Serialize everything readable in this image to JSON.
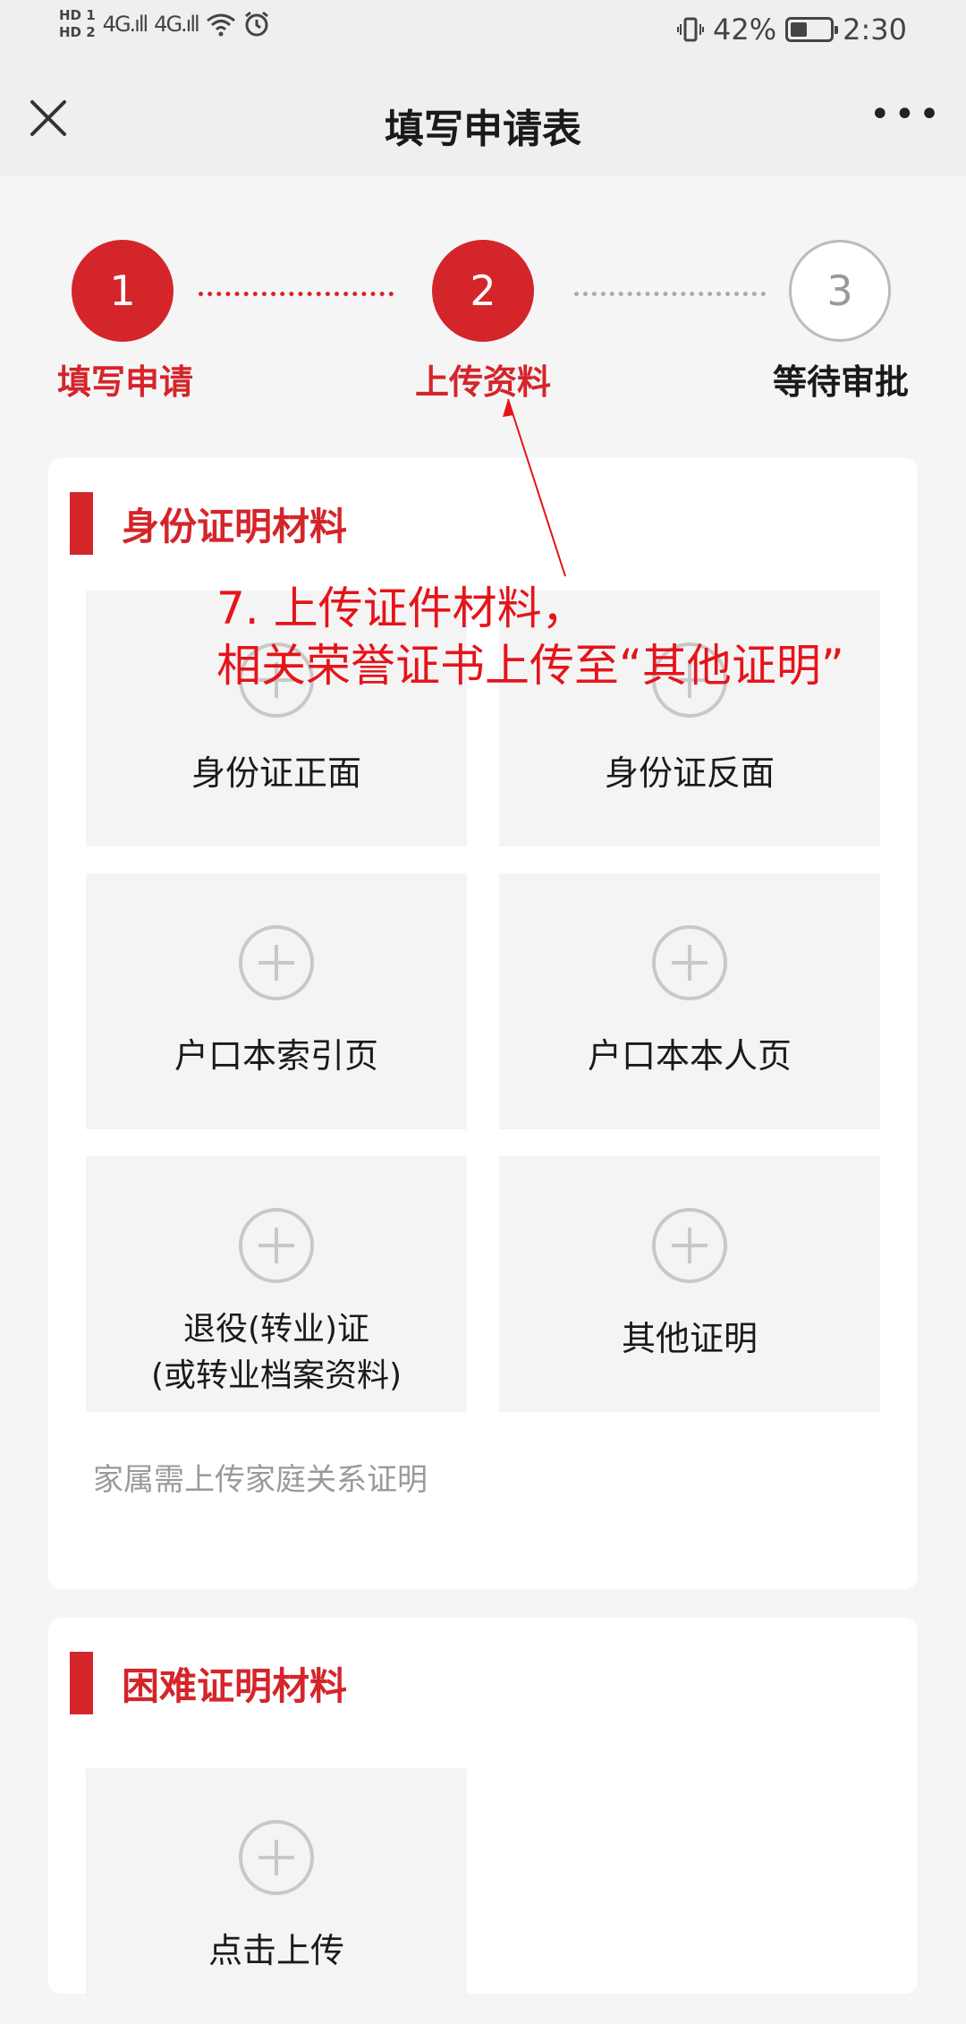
{
  "status_bar": {
    "left_hd1": "HD 1",
    "left_hd2": "HD 2",
    "signal1": "4G.ıll",
    "signal2": "4G.ıll",
    "battery_text": "42%",
    "time": "2:30",
    "battery_level_percent": 42
  },
  "nav": {
    "title": "填写申请表",
    "more": "•••"
  },
  "stepper": {
    "steps": [
      {
        "number": "1",
        "label": "填写申请"
      },
      {
        "number": "2",
        "label": "上传资料"
      },
      {
        "number": "3",
        "label": "等待审批"
      }
    ]
  },
  "identity_section": {
    "title": "身份证明材料",
    "tiles": [
      {
        "label": "身份证正面"
      },
      {
        "label": "身份证反面"
      },
      {
        "label": "户口本索引页"
      },
      {
        "label": "户口本本人页"
      },
      {
        "label_line1": "退役(转业)证",
        "label_line2": "(或转业档案资料)"
      },
      {
        "label": "其他证明"
      }
    ],
    "hint": "家属需上传家庭关系证明"
  },
  "hardship_section": {
    "title": "困难证明材料",
    "tiles": [
      {
        "label": "点击上传"
      }
    ]
  },
  "annotation": {
    "line1": "7. 上传证件材料，",
    "line2": "相关荣誉证书上传至“其他证明”"
  },
  "colors": {
    "accent": "#d4252b",
    "annotation": "#e5141a"
  }
}
